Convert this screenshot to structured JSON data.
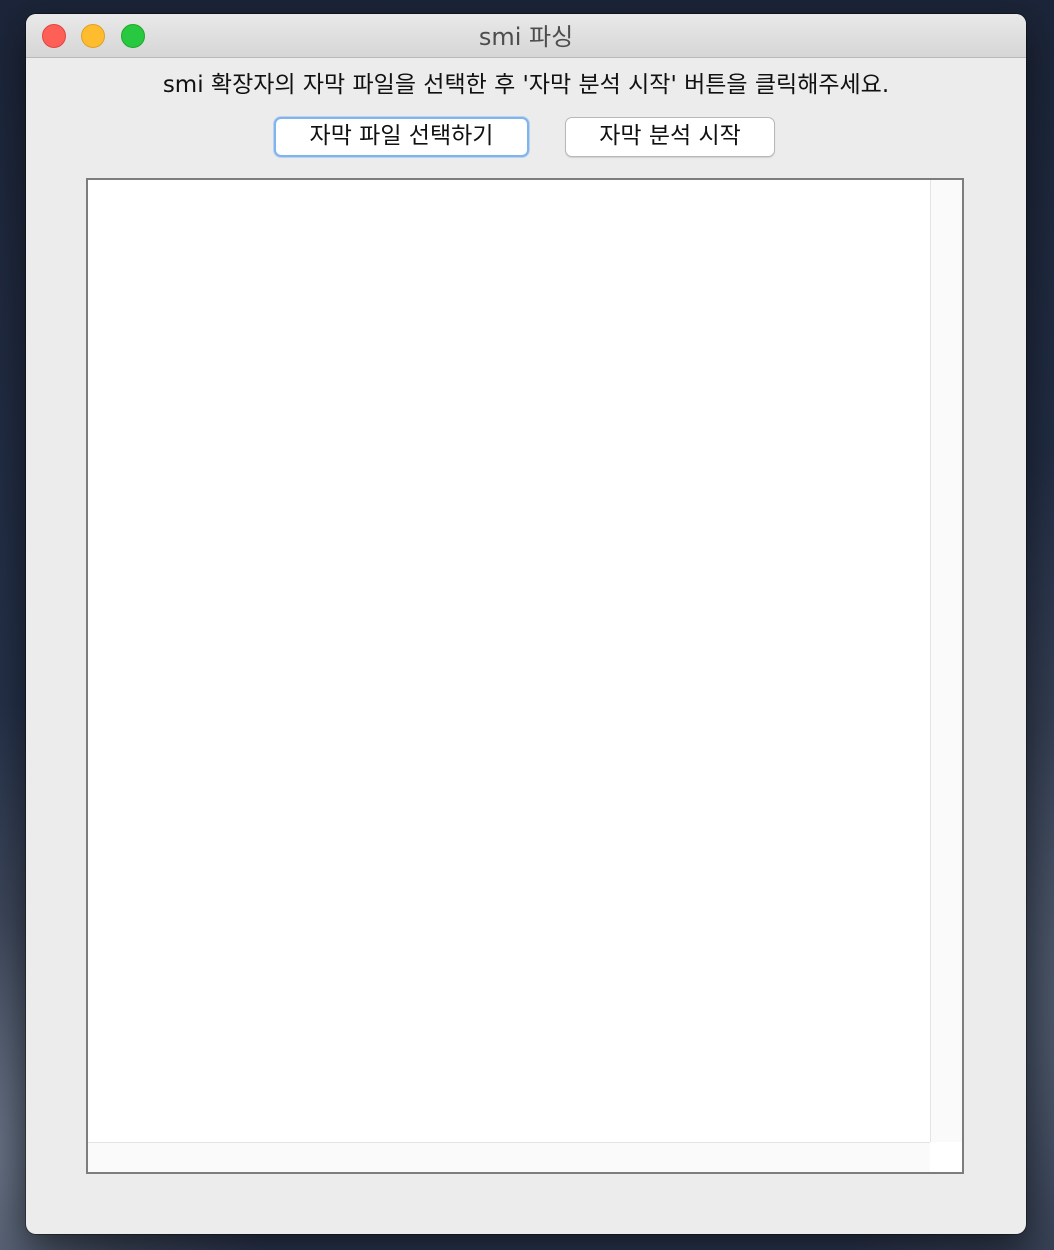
{
  "window": {
    "title": "smi 파싱"
  },
  "instruction": "smi 확장자의 자막 파일을 선택한 후 '자막 분석 시작' 버튼을 클릭해주세요.",
  "buttons": {
    "select_file": "자막 파일 선택하기",
    "start_analysis": "자막 분석 시작"
  },
  "output": {
    "text": ""
  },
  "colors": {
    "close": "#fe5f57",
    "minimize": "#febc2e",
    "zoom": "#28c840",
    "focus_ring": "#80b4ef",
    "window_bg": "#ececec"
  }
}
